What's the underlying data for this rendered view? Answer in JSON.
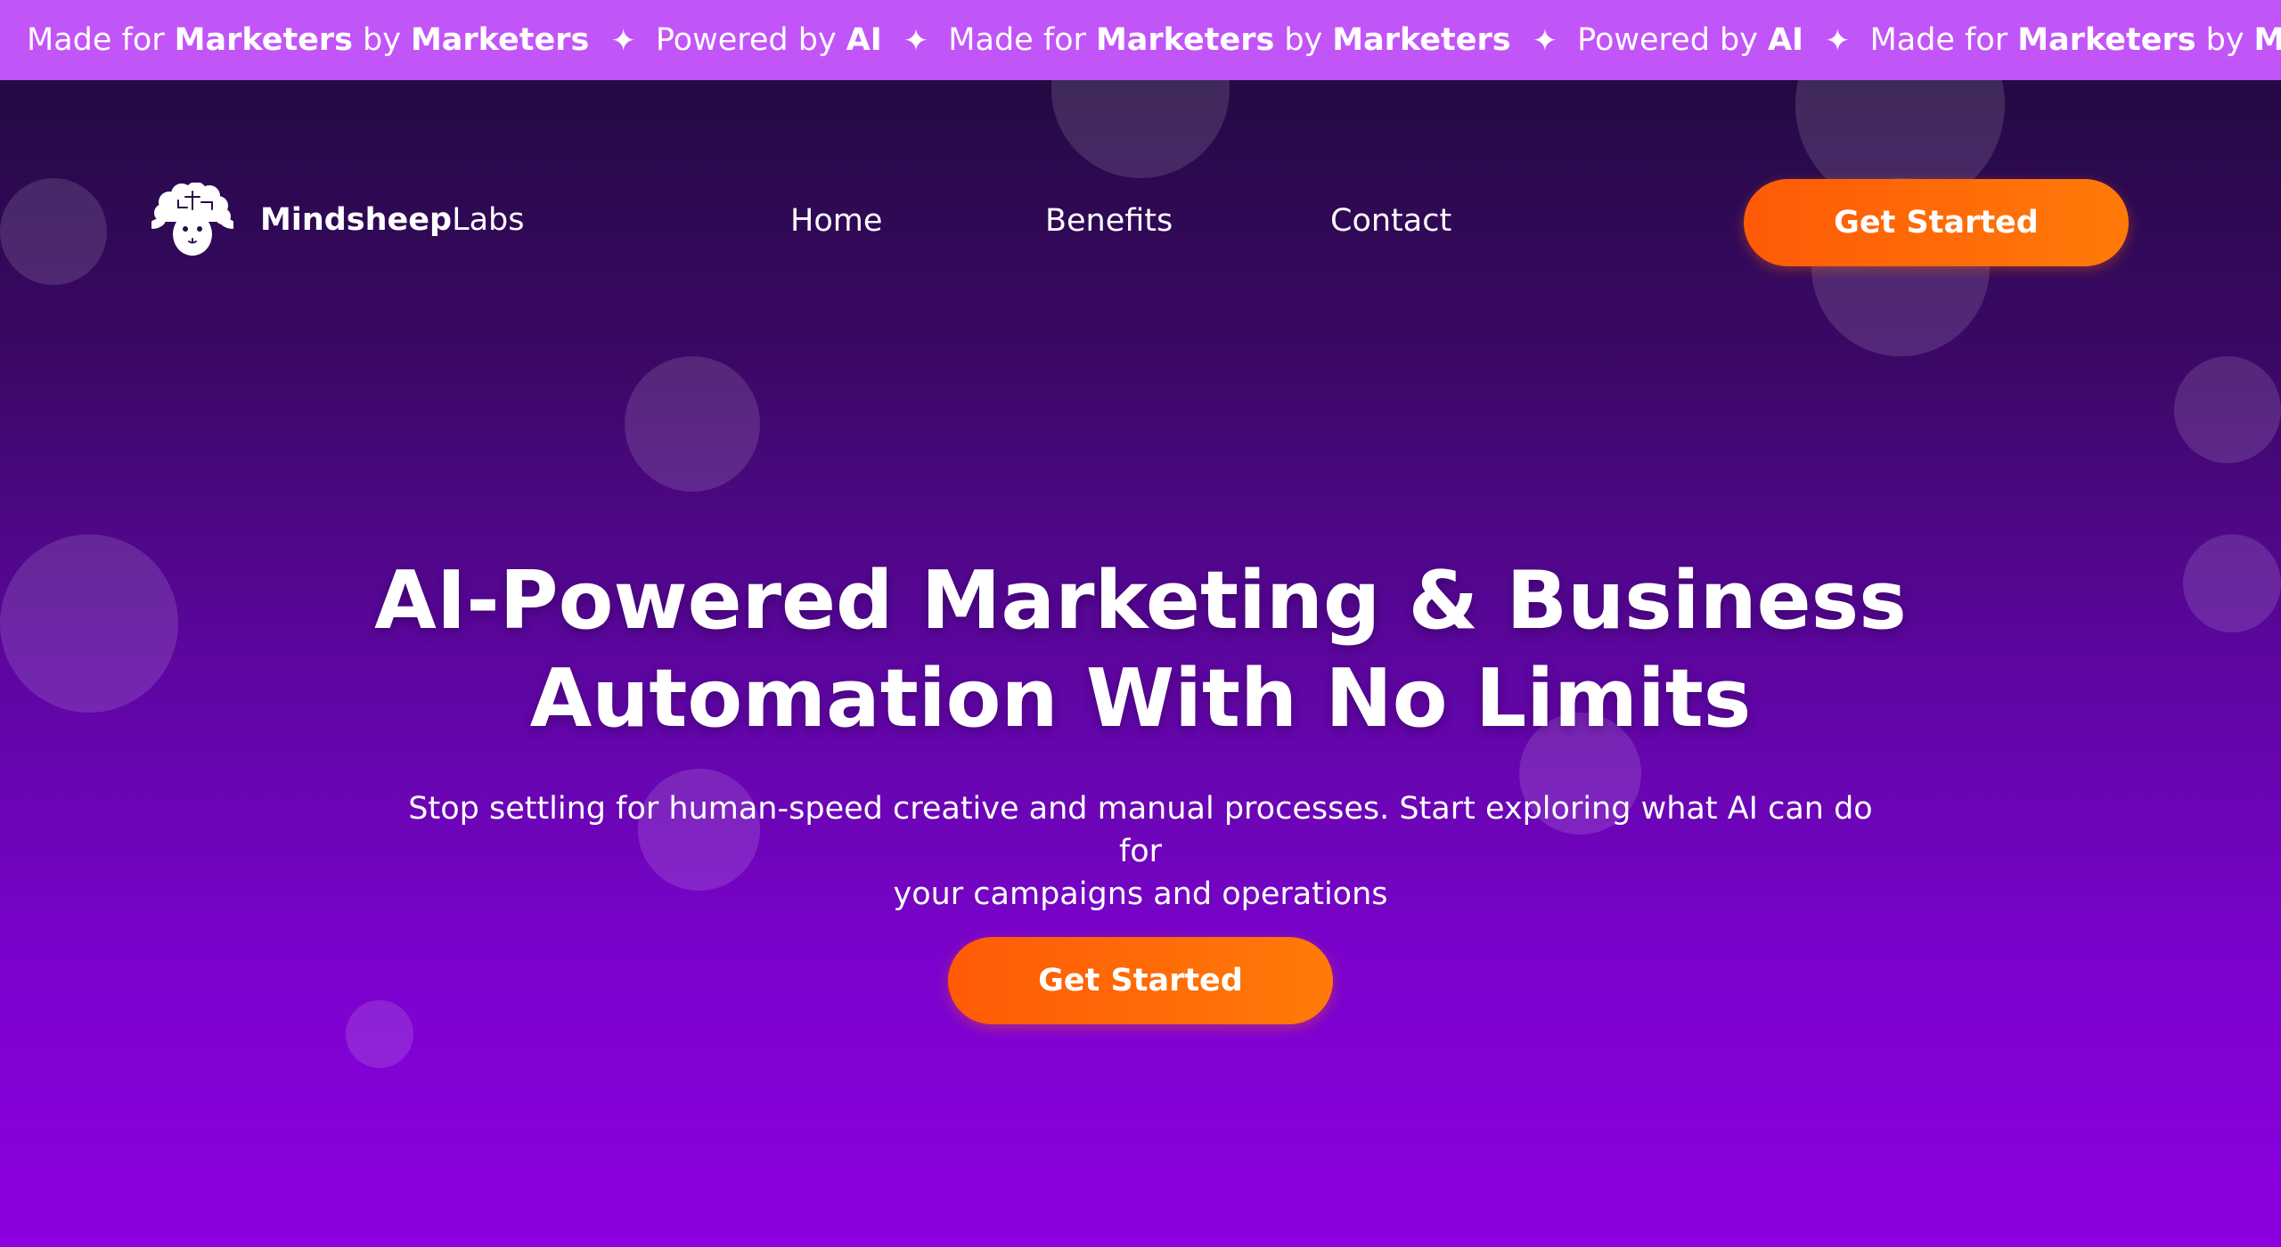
{
  "ticker": {
    "items": [
      {
        "type": "made",
        "prefix": "Made for",
        "bold1": "Marketers",
        "mid": "by",
        "bold2": "Marketers"
      },
      {
        "type": "powered",
        "prefix": "Powered by",
        "bold": "AI"
      },
      {
        "type": "made",
        "prefix": "Made for",
        "bold1": "Marketers",
        "mid": "by",
        "bold2": "Marketers"
      },
      {
        "type": "powered",
        "prefix": "Powered by",
        "bold": "AI"
      },
      {
        "type": "made",
        "prefix": "Made for",
        "bold1": "Marketers",
        "mid": "by",
        "bold2": "Marketers"
      }
    ],
    "separator": "✦"
  },
  "nav": {
    "brand_bold": "Mindsheep",
    "brand_light": "Labs",
    "logo_icon": "sheep-brain-icon",
    "links": [
      "Home",
      "Benefits",
      "Contact"
    ],
    "cta_label": "Get Started"
  },
  "hero": {
    "headline_line1": "AI-Powered Marketing & Business",
    "headline_line2": "Automation With No Limits",
    "subtitle_line1": "Stop settling for human-speed creative and manual processes. Start exploring what AI can do for",
    "subtitle_line2": "your campaigns and operations",
    "cta_label": "Get Started"
  },
  "colors": {
    "ticker_bg": "#c255f7",
    "hero_top": "#230a43",
    "hero_bottom": "#8d00e0",
    "cta": "#ff6a06"
  }
}
